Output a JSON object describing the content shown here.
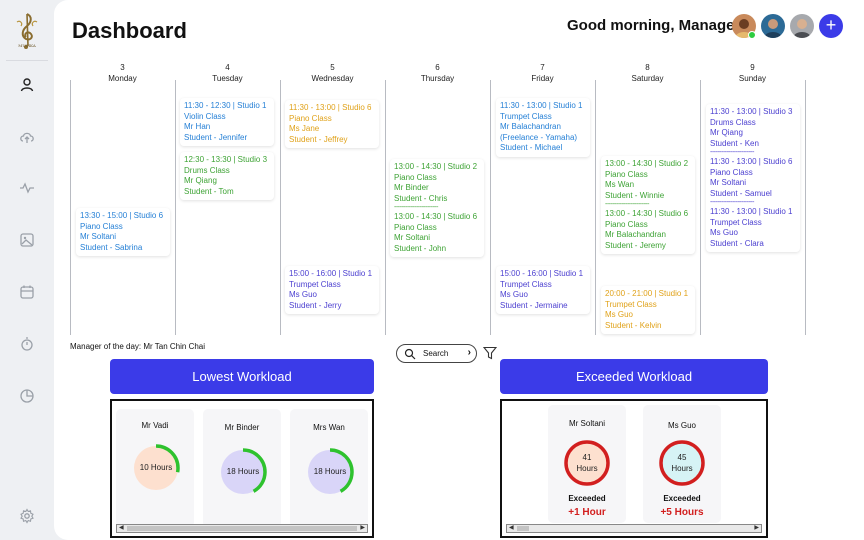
{
  "header": {
    "title": "Dashboard",
    "greeting": "Good morning, Manager!",
    "logo_text": "MUSIKA"
  },
  "sidebar": {
    "items": [
      {
        "icon": "user-icon"
      },
      {
        "icon": "cloud-upload-icon"
      },
      {
        "icon": "activity-icon"
      },
      {
        "icon": "image-icon"
      },
      {
        "icon": "calendar-icon"
      },
      {
        "icon": "timer-icon"
      },
      {
        "icon": "pie-chart-icon"
      },
      {
        "icon": "settings-icon"
      }
    ]
  },
  "calendar": {
    "days": [
      {
        "num": "3",
        "name": "Monday"
      },
      {
        "num": "4",
        "name": "Tuesday"
      },
      {
        "num": "5",
        "name": "Wednesday"
      },
      {
        "num": "6",
        "name": "Thursday"
      },
      {
        "num": "7",
        "name": "Friday"
      },
      {
        "num": "8",
        "name": "Saturday"
      },
      {
        "num": "9",
        "name": "Sunday"
      }
    ],
    "events": {
      "mon": {
        "time": "13:30 - 15:00 | Studio 6",
        "cls": "Piano Class",
        "teacher": "Mr Soltani",
        "student": "Student - Sabrina"
      },
      "tue1": {
        "time": "11:30 - 12:30 | Studio 1",
        "cls": "Violin Class",
        "teacher": "Mr Han",
        "student": "Student - Jennifer"
      },
      "tue2": {
        "time": "12:30 - 13:30 | Studio 3",
        "cls": "Drums Class",
        "teacher": "Mr Qiang",
        "student": "Student - Tom"
      },
      "wed1": {
        "time": "11:30 - 13:00 | Studio 6",
        "cls": "Piano Class",
        "teacher": "Ms Jane",
        "student": "Student - Jeffrey"
      },
      "wed2": {
        "time": "15:00 - 16:00 | Studio 1",
        "cls": "Trumpet Class",
        "teacher": "Ms Guo",
        "student": "Student - Jerry"
      },
      "thu1": {
        "time": "13:00 - 14:30 | Studio 2",
        "cls": "Piano Class",
        "teacher": "Mr Binder",
        "student": "Student - Chris"
      },
      "thu2": {
        "time": "13:00 - 14:30 | Studio 6",
        "cls": "Piano Class",
        "teacher": "Mr Soltani",
        "student": "Student - John"
      },
      "fri1": {
        "time": "11:30 - 13:00 | Studio 1",
        "cls": "Trumpet Class",
        "teacher": "Mr Balachandran",
        "teacher2": "(Freelance - Yamaha)",
        "student": "Student - Michael"
      },
      "fri2": {
        "time": "15:00 - 16:00 | Studio 1",
        "cls": "Trumpet Class",
        "teacher": "Ms Guo",
        "student": "Student - Jermaine"
      },
      "sat1": {
        "time": "13:00 - 14:30 | Studio 2",
        "cls": "Piano Class",
        "teacher": "Ms Wan",
        "student": "Student - Winnie"
      },
      "sat2": {
        "time": "13:00 - 14:30 | Studio 6",
        "cls": "Piano Class",
        "teacher": "Mr Balachandran",
        "student": "Student - Jeremy"
      },
      "sat3": {
        "time": "20:00 - 21:00 | Studio 1",
        "cls": "Trumpet Class",
        "teacher": "Ms Guo",
        "student": "Student - Kelvin"
      },
      "sun1": {
        "time": "11:30 - 13:00 | Studio 3",
        "cls": "Drums Class",
        "teacher": "Mr Qiang",
        "student": "Student - Ken"
      },
      "sun2": {
        "time": "11:30 - 13:00 | Studio 6",
        "cls": "Piano Class",
        "teacher": "Mr Soltani",
        "student": "Student - Samuel"
      },
      "sun3": {
        "time": "11:30 - 13:00 | Studio 1",
        "cls": "Trumpet Class",
        "teacher": "Ms Guo",
        "student": "Student - Clara"
      },
      "separator": "------------------------"
    }
  },
  "manager_of_day": "Manager of the day: Mr Tan Chin Chai",
  "search": {
    "label": "Search"
  },
  "lowest": {
    "button": "Lowest Workload",
    "cards": [
      {
        "name": "Mr Vadi",
        "hours": "10 Hours",
        "fill": 0.28
      },
      {
        "name": "Mr Binder",
        "hours": "18 Hours",
        "fill": 0.42
      },
      {
        "name": "Mrs Wan",
        "hours": "18 Hours",
        "fill": 0.42
      }
    ]
  },
  "exceeded": {
    "button": "Exceeded Workload",
    "cards": [
      {
        "name": "Mr Soltani",
        "hours_num": "41",
        "hours_unit": "Hours",
        "label": "Exceeded",
        "extra": "+1 Hour"
      },
      {
        "name": "Ms Guo",
        "hours_num": "45",
        "hours_unit": "Hours",
        "label": "Exceeded",
        "extra": "+5 Hours"
      }
    ]
  },
  "colors": {
    "accent": "#3b3be8",
    "blue": "#2680d6",
    "green": "#3ea335",
    "orange": "#e0a21a",
    "purple": "#4b3fd0",
    "alert": "#d21f1f"
  }
}
